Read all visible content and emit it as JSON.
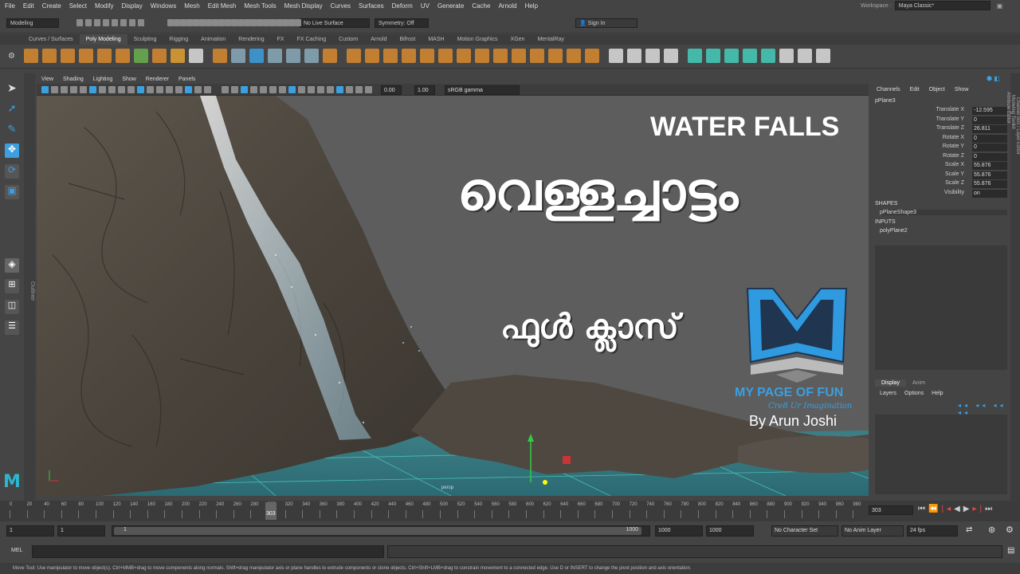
{
  "menubar": [
    "File",
    "Edit",
    "Create",
    "Select",
    "Modify",
    "Display",
    "Windows",
    "Mesh",
    "Edit Mesh",
    "Mesh Tools",
    "Mesh Display",
    "Curves",
    "Surfaces",
    "Deform",
    "UV",
    "Generate",
    "Cache",
    "Arnold",
    "Help"
  ],
  "workspace": {
    "label": "Workspace :",
    "value": "Maya Classic*"
  },
  "status": {
    "mode": "Modeling",
    "live_surface": "No Live Surface",
    "symmetry": "Symmetry: Off",
    "sign_in": "Sign In"
  },
  "shelf_tabs": [
    "Curves / Surfaces",
    "Poly Modeling",
    "Sculpting",
    "Rigging",
    "Animation",
    "Rendering",
    "FX",
    "FX Caching",
    "Custom",
    "Arnold",
    "Bifrost",
    "MASH",
    "Motion Graphics",
    "XGen",
    "MentalRay"
  ],
  "shelf_active": "Poly Modeling",
  "outliner_label": "Outliner",
  "panel_menu": [
    "View",
    "Shading",
    "Lighting",
    "Show",
    "Renderer",
    "Panels"
  ],
  "view_toolbar": {
    "exposure": "0.00",
    "gamma": "1.00",
    "color_space": "sRGB gamma"
  },
  "viewport": {
    "camera_label": "persp",
    "title_en": "WATER FALLS",
    "title_ml": "വെള്ളച്ചാട്ടം",
    "subtitle_ml": "ഫുൾ ക്ലാസ്",
    "brand_name": "MY PAGE OF FUN",
    "brand_tagline": "Cre8 Ur Imagination",
    "author": "By Arun Joshi",
    "logo_letter": "M"
  },
  "channel_box": {
    "menu": [
      "Channels",
      "Edit",
      "Object",
      "Show"
    ],
    "object": "pPlane3",
    "rows": [
      {
        "label": "Translate X",
        "value": "-12.595"
      },
      {
        "label": "Translate Y",
        "value": "0"
      },
      {
        "label": "Translate Z",
        "value": "26.811"
      },
      {
        "label": "Rotate X",
        "value": "0"
      },
      {
        "label": "Rotate Y",
        "value": "0"
      },
      {
        "label": "Rotate Z",
        "value": "0"
      },
      {
        "label": "Scale X",
        "value": "55.876"
      },
      {
        "label": "Scale Y",
        "value": "55.876"
      },
      {
        "label": "Scale Z",
        "value": "55.876"
      },
      {
        "label": "Visibility",
        "value": "on"
      }
    ],
    "shapes_header": "SHAPES",
    "shape": "pPlaneShape3",
    "inputs_header": "INPUTS",
    "input": "polyPlane2"
  },
  "layer_editor": {
    "tabs": [
      "Display",
      "Anim"
    ],
    "menu": [
      "Layers",
      "Options",
      "Help"
    ]
  },
  "right_tabs": [
    "Channel Box / Layer Editor",
    "Modeling Toolkit",
    "Attribute Editor"
  ],
  "timeline": {
    "ticks": [
      "0",
      "20",
      "40",
      "60",
      "80",
      "100",
      "120",
      "140",
      "160",
      "180",
      "200",
      "220",
      "240",
      "260",
      "280",
      "300",
      "320",
      "340",
      "360",
      "380",
      "400",
      "420",
      "440",
      "460",
      "480",
      "500",
      "520",
      "540",
      "560",
      "580",
      "600",
      "620",
      "640",
      "660",
      "680",
      "700",
      "720",
      "740",
      "760",
      "780",
      "800",
      "820",
      "840",
      "860",
      "880",
      "900",
      "920",
      "940",
      "960",
      "980",
      "100"
    ],
    "current_frame": "303",
    "current_field": "303"
  },
  "range": {
    "start": "1",
    "start2": "1",
    "slider_start": "1",
    "slider_end": "1000",
    "end": "1000",
    "end2": "1000",
    "character_set": "No Character Set",
    "anim_layer": "No Anim Layer",
    "fps": "24 fps"
  },
  "cmd": {
    "label": "MEL"
  },
  "help_line": "Move Tool: Use manipulator to move object(s). Ctrl+MMB+drag to move components along normals. Shift+drag manipulator axis or plane handles to extrude components or clone objects. Ctrl+Shift+LMB+drag to constrain movement to a connected edge. Use D or INSERT to change the pivot position and axis orientation.",
  "colors": {
    "accent": "#3b9fe0",
    "logo_blue": "#2f9ae0",
    "logo_dark": "#1f3550",
    "ui_bg": "#444444",
    "viewport_bg": "#5d5d5d"
  }
}
